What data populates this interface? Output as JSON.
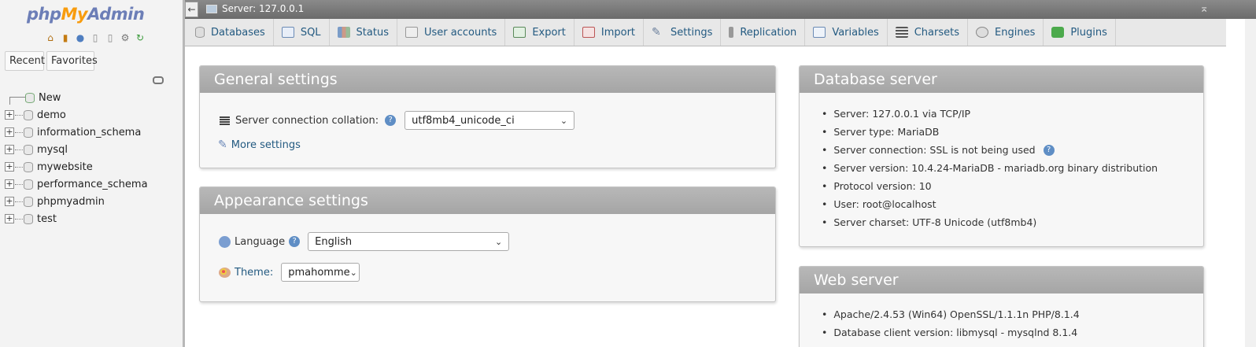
{
  "app": {
    "logo_php": "php",
    "logo_my": "My",
    "logo_admin": "Admin"
  },
  "sidebar": {
    "recent_label": "Recent",
    "favorites_label": "Favorites",
    "new_label": "New",
    "databases": [
      "demo",
      "information_schema",
      "mysql",
      "mywebsite",
      "performance_schema",
      "phpmyadmin",
      "test"
    ]
  },
  "topbar": {
    "server_label": "Server: 127.0.0.1"
  },
  "tabs": [
    {
      "label": "Databases",
      "icon": "database-icon"
    },
    {
      "label": "SQL",
      "icon": "sql-icon"
    },
    {
      "label": "Status",
      "icon": "status-icon"
    },
    {
      "label": "User accounts",
      "icon": "users-icon"
    },
    {
      "label": "Export",
      "icon": "export-icon"
    },
    {
      "label": "Import",
      "icon": "import-icon"
    },
    {
      "label": "Settings",
      "icon": "wrench-icon"
    },
    {
      "label": "Replication",
      "icon": "replication-icon"
    },
    {
      "label": "Variables",
      "icon": "variables-icon"
    },
    {
      "label": "Charsets",
      "icon": "charsets-icon"
    },
    {
      "label": "Engines",
      "icon": "engines-icon"
    },
    {
      "label": "Plugins",
      "icon": "plugins-icon"
    }
  ],
  "general_settings": {
    "title": "General settings",
    "collation_label": "Server connection collation:",
    "collation_value": "utf8mb4_unicode_ci",
    "more_settings": "More settings"
  },
  "appearance_settings": {
    "title": "Appearance settings",
    "language_label": "Language",
    "language_value": "English",
    "theme_label": "Theme:",
    "theme_value": "pmahomme"
  },
  "database_server": {
    "title": "Database server",
    "items": [
      "Server: 127.0.0.1 via TCP/IP",
      "Server type: MariaDB",
      "Server connection: SSL is not being used",
      "Server version: 10.4.24-MariaDB - mariadb.org binary distribution",
      "Protocol version: 10",
      "User: root@localhost",
      "Server charset: UTF-8 Unicode (utf8mb4)"
    ]
  },
  "web_server": {
    "title": "Web server",
    "items": [
      "Apache/2.4.53 (Win64) OpenSSL/1.1.1n PHP/8.1.4",
      "Database client version: libmysql - mysqlnd 8.1.4"
    ]
  },
  "colors": {
    "link": "#235a81",
    "panel_header": "#a9a9a9",
    "logo_blue": "#6c7eb7",
    "logo_orange": "#f89c0e"
  }
}
